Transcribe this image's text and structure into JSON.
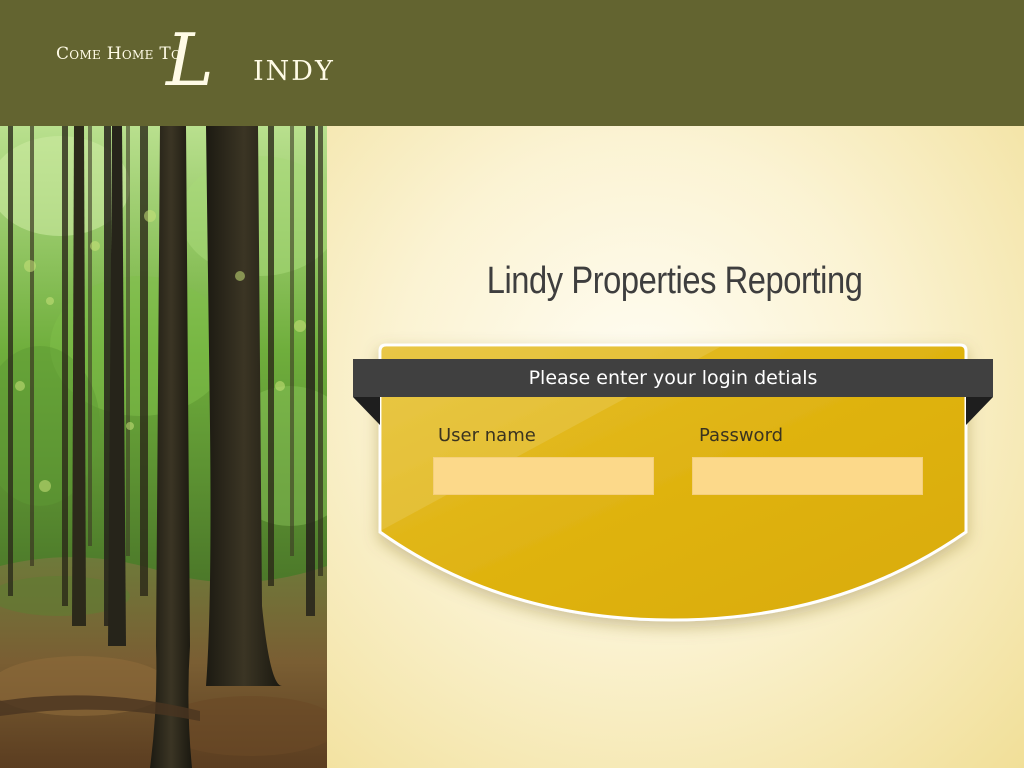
{
  "header": {
    "logo_prefix": "Come Home To",
    "logo_initial": "L",
    "logo_rest": "INDY"
  },
  "main": {
    "title": "Lindy Properties Reporting"
  },
  "login": {
    "banner_text": "Please enter your login detials",
    "username_label": "User name",
    "username_value": "",
    "password_label": "Password",
    "password_value": ""
  },
  "colors": {
    "header_bg": "#636430",
    "card_fill": "#dfb311",
    "banner_bg": "#404040",
    "field_bg": "#fcd98a",
    "title_text": "#3e3e3e"
  }
}
